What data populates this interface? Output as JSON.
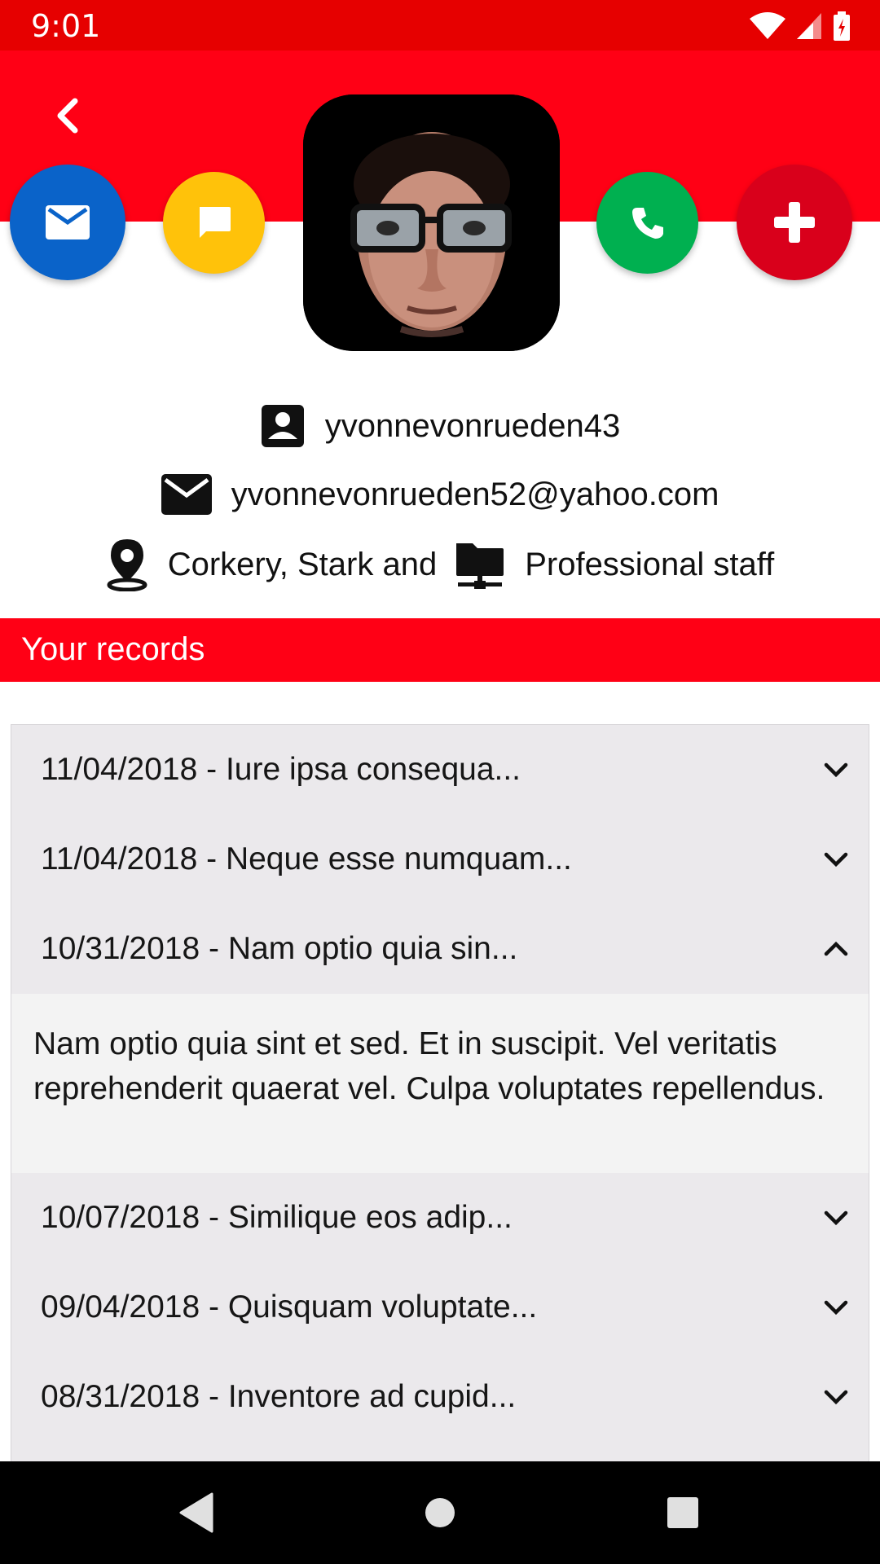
{
  "status": {
    "time": "9:01"
  },
  "profile": {
    "username": "yvonnevonrueden43",
    "email": "yvonnevonrueden52@yahoo.com",
    "company": "Corkery, Stark and",
    "role": "Professional staff"
  },
  "actions": [
    "email",
    "message",
    "call",
    "add"
  ],
  "records_section": {
    "title": "Your records"
  },
  "records": [
    {
      "label": "11/04/2018 - Iure ipsa consequa...",
      "expanded": false
    },
    {
      "label": "11/04/2018 - Neque esse numquam...",
      "expanded": false
    },
    {
      "label": "10/31/2018 - Nam optio quia sin...",
      "expanded": true,
      "body": "Nam optio quia sint et sed. Et in suscipit. Vel veritatis reprehenderit quaerat vel. Culpa voluptates repellendus."
    },
    {
      "label": "10/07/2018 - Similique eos adip...",
      "expanded": false
    },
    {
      "label": "09/04/2018 - Quisquam voluptate...",
      "expanded": false
    },
    {
      "label": "08/31/2018 - Inventore ad cupid...",
      "expanded": false
    }
  ],
  "colors": {
    "header_red": "#ff0015",
    "status_red": "#e60000",
    "email_blue": "#0a63c9",
    "message_yellow": "#ffc20a",
    "call_green": "#00b050",
    "add_red": "#d9001b",
    "list_bg": "#ebe9ec",
    "expanded_bg": "#f3f3f3"
  },
  "icons": {
    "back": "arrow-back-icon",
    "email": "mail-icon",
    "message": "chat-bubble-icon",
    "call": "phone-icon",
    "add": "plus-icon",
    "user": "account-box-icon",
    "location": "location-pin-icon",
    "org": "folder-network-icon",
    "expand": "chevron-down-icon",
    "collapse": "chevron-up-icon"
  }
}
